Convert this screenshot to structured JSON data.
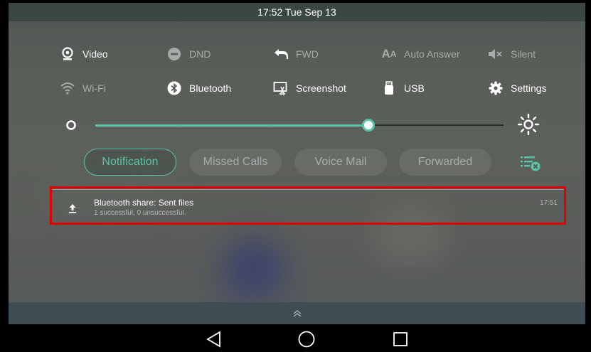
{
  "status_bar": {
    "time": "17:52 Tue Sep 13"
  },
  "quick_toggles": {
    "row1": [
      {
        "label": "Video",
        "icon": "video-camera-icon",
        "state": "on"
      },
      {
        "label": "DND",
        "icon": "dnd-icon",
        "state": "off"
      },
      {
        "label": "FWD",
        "icon": "forward-icon",
        "state": "off"
      },
      {
        "label": "Auto Answer",
        "icon": "auto-answer-icon",
        "state": "off"
      },
      {
        "label": "Silent",
        "icon": "silent-icon",
        "state": "off"
      }
    ],
    "row2": [
      {
        "label": "Wi-Fi",
        "icon": "wifi-icon",
        "state": "off"
      },
      {
        "label": "Bluetooth",
        "icon": "bluetooth-icon",
        "state": "on"
      },
      {
        "label": "Screenshot",
        "icon": "screenshot-icon",
        "state": "on"
      },
      {
        "label": "USB",
        "icon": "usb-icon",
        "state": "on"
      },
      {
        "label": "Settings",
        "icon": "gear-icon",
        "state": "on"
      }
    ]
  },
  "brightness": {
    "level": 0.68,
    "accent": "#5ec4a8"
  },
  "tabs": [
    {
      "label": "Notification",
      "active": true
    },
    {
      "label": "Missed Calls",
      "active": false
    },
    {
      "label": "Voice Mail",
      "active": false
    },
    {
      "label": "Forwarded",
      "active": false
    }
  ],
  "notification": {
    "icon": "upload-icon",
    "title": "Bluetooth share: Sent files",
    "subtitle": "1 successful, 0 unsuccessful.",
    "time": "17:51"
  },
  "colors": {
    "accent": "#5ec4a8",
    "highlight": "#e00000"
  }
}
